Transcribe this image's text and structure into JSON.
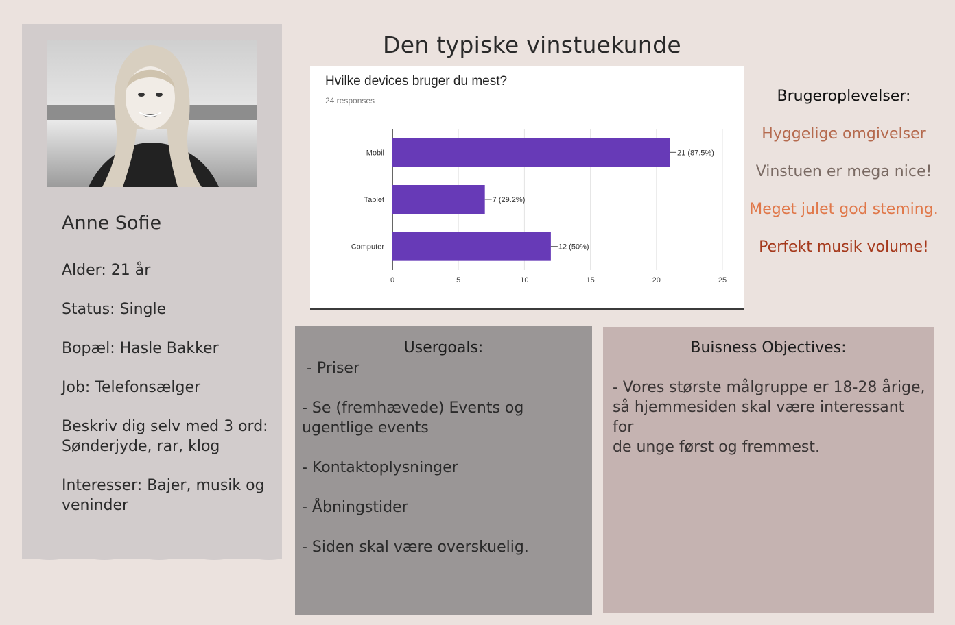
{
  "page": {
    "title": "Den typiske vinstuekunde"
  },
  "profile": {
    "name": "Anne Sofie",
    "age": "Alder: 21 år",
    "status": "Status: Single",
    "residence": "Bopæl: Hasle Bakker",
    "job": "Job: Telefonsælger",
    "describe": "Beskriv dig selv med 3 ord:\nSønderjyde, rar, klog",
    "interests": "Interesser: Bajer, musik og\nveninder"
  },
  "user_experiences": {
    "heading": "Brugeroplevelser:",
    "items": [
      {
        "text": "Hyggelige omgivelser",
        "color": "#b56a4e"
      },
      {
        "text": "Vinstuen er mega nice!",
        "color": "#7a6a63"
      },
      {
        "text": "Meget julet god steming.",
        "color": "#e0784a"
      },
      {
        "text": "Perfekt musik volume!",
        "color": "#a5391c"
      }
    ]
  },
  "usergoals": {
    "heading": "Usergoals:",
    "items": [
      " - Priser",
      "- Se (fremhævede) Events og\nugentlige events",
      "- Kontaktoplysninger",
      "- Åbningstider",
      "- Siden skal være overskuelig."
    ]
  },
  "business": {
    "heading": "Buisness Objectives:",
    "text": "- Vores største målgruppe er 18-28 årige,\nså hjemmesiden skal være interessant for\nde unge først og fremmest."
  },
  "chart_data": {
    "type": "bar",
    "orientation": "horizontal",
    "title": "Hvilke devices bruger du mest?",
    "subtitle": "24 responses",
    "categories": [
      "Mobil",
      "Tablet",
      "Computer"
    ],
    "values": [
      21,
      7,
      12
    ],
    "data_labels": [
      "21 (87.5%)",
      "7 (29.2%)",
      "12 (50%)"
    ],
    "xlim": [
      0,
      25
    ],
    "xticks": [
      0,
      5,
      10,
      15,
      20,
      25
    ],
    "bar_color": "#673ab7",
    "grid": true
  }
}
